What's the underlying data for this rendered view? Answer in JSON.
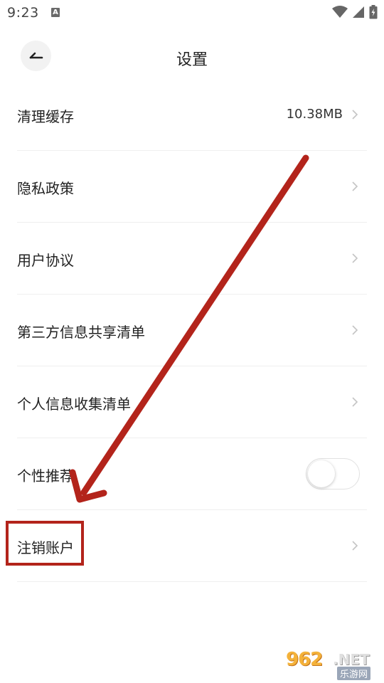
{
  "status_bar": {
    "time": "9:23",
    "notification_icon_letter": "A",
    "icons": [
      "wifi-icon",
      "signal-icon",
      "battery-charging-icon"
    ]
  },
  "header": {
    "title": "设置",
    "back_icon": "back-arrow-icon"
  },
  "settings": {
    "items": [
      {
        "label": "清理缓存",
        "value": "10.38MB",
        "type": "link"
      },
      {
        "label": "隐私政策",
        "type": "link"
      },
      {
        "label": "用户协议",
        "type": "link"
      },
      {
        "label": "第三方信息共享清单",
        "type": "link"
      },
      {
        "label": "个人信息收集清单",
        "type": "link"
      },
      {
        "label": "个性推荐",
        "type": "toggle",
        "toggle_on": false
      },
      {
        "label": "注销账户",
        "type": "link"
      }
    ]
  },
  "annotation": {
    "color": "#b3241b",
    "highlighted_item": "注销账户"
  },
  "watermark": {
    "logo": "962",
    "tld": ".NET",
    "cn_text": "乐游网"
  }
}
